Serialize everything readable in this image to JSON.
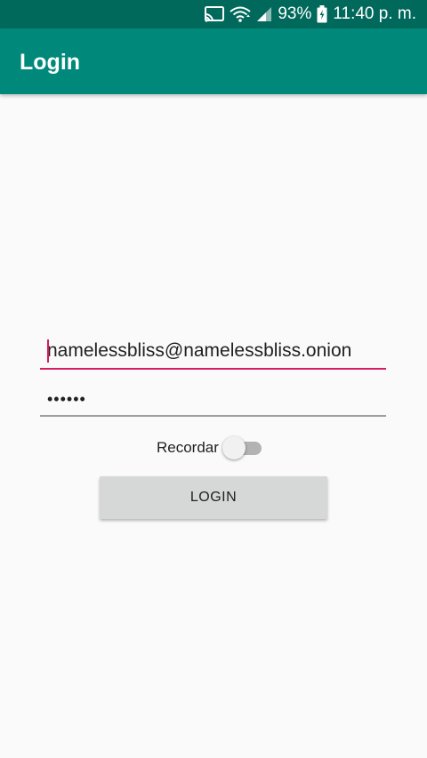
{
  "status_bar": {
    "battery": "93%",
    "time": "11:40 p. m.",
    "icons": [
      "cast-icon",
      "wifi-icon",
      "signal-icon",
      "battery-icon"
    ]
  },
  "app_bar": {
    "title": "Login"
  },
  "login_form": {
    "email_value": "namelessbliss@namelessbliss.onion",
    "password_value": "••••••",
    "remember_label": "Recordar",
    "remember_checked": false,
    "login_button_label": "LOGIN"
  },
  "colors": {
    "status_bar": "#00695c",
    "app_bar": "#00897b",
    "accent": "#d81b60",
    "background": "#fafafa",
    "button": "#d6d7d7"
  }
}
